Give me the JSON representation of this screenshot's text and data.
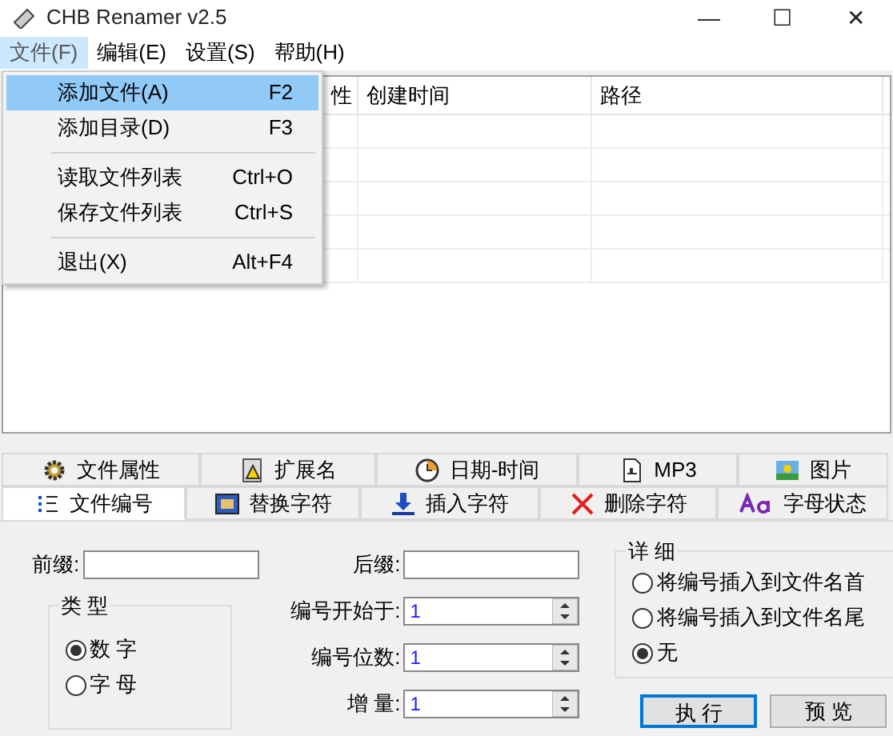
{
  "window": {
    "title": "CHB Renamer v2.5",
    "controls": [
      "—",
      "☐",
      "✕"
    ]
  },
  "menu_bar": [
    {
      "label": "文件(F)",
      "selected": true
    },
    {
      "label": "编辑(E)",
      "selected": false
    },
    {
      "label": "设置(S)",
      "selected": false
    },
    {
      "label": "帮助(H)",
      "selected": false
    }
  ],
  "file_menu": [
    {
      "label": "添加文件(A)",
      "shortcut": "F2",
      "selected": true,
      "separator_after": false
    },
    {
      "label": "添加目录(D)",
      "shortcut": "F3",
      "selected": false,
      "separator_after": true
    },
    {
      "label": "读取文件列表",
      "shortcut": "Ctrl+O",
      "selected": false,
      "separator_after": false
    },
    {
      "label": "保存文件列表",
      "shortcut": "Ctrl+S",
      "selected": false,
      "separator_after": true
    },
    {
      "label": "退出(X)",
      "shortcut": "Alt+F4",
      "selected": false,
      "separator_after": false
    }
  ],
  "table": {
    "columns": [
      "性",
      "创建时间",
      "路径"
    ]
  },
  "tabs_row_1": [
    {
      "label": "文件属性",
      "kind": "gear"
    },
    {
      "label": "扩展名",
      "kind": "warning"
    },
    {
      "label": "日期-时间",
      "kind": "clock"
    },
    {
      "label": "MP3",
      "kind": "file"
    },
    {
      "label": "图片",
      "kind": "image"
    }
  ],
  "tabs_row_2": [
    {
      "label": "文件编号",
      "kind": "list",
      "selected": true
    },
    {
      "label": "替换字符",
      "kind": "replace",
      "selected": false
    },
    {
      "label": "插入字符",
      "kind": "insert",
      "selected": false
    },
    {
      "label": "删除字符",
      "kind": "delete",
      "selected": false
    },
    {
      "label": "字母状态",
      "kind": "aa",
      "selected": false
    }
  ],
  "numbering": {
    "prefix_label": "前缀:",
    "suffix_label": "后缀:",
    "type_group": {
      "title": "类 型",
      "options": [
        {
          "label": "数 字",
          "selected": true
        },
        {
          "label": "字 母",
          "selected": false
        }
      ]
    },
    "spinners": [
      {
        "label": "编号开始于:",
        "value": "1"
      },
      {
        "label": "编号位数:",
        "value": "1"
      },
      {
        "label": "增 量:",
        "value": "1"
      }
    ],
    "detail_group": {
      "title": "详 细",
      "options": [
        {
          "label": "将编号插入到文件名首",
          "selected": false
        },
        {
          "label": "将编号插入到文件名尾",
          "selected": false
        },
        {
          "label": "无",
          "selected": true
        }
      ]
    },
    "buttons": [
      {
        "label": "执 行",
        "default": true
      },
      {
        "label": "预 览",
        "default": false
      }
    ]
  }
}
